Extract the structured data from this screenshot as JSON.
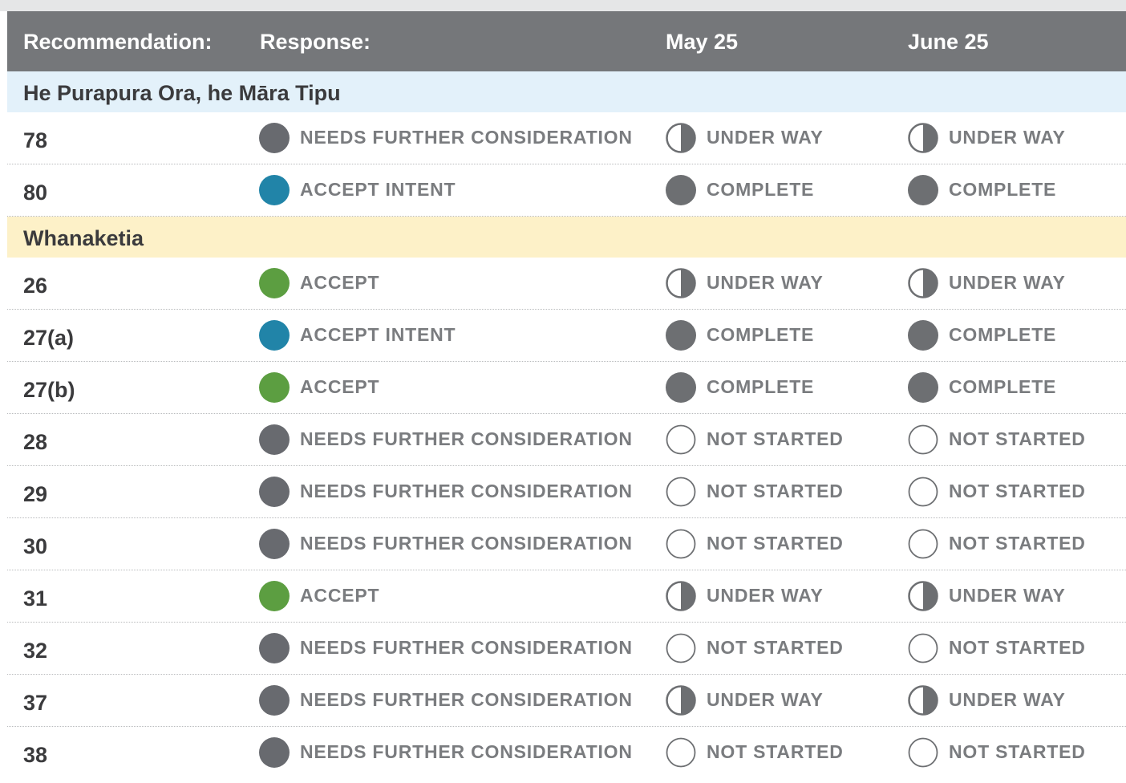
{
  "colors": {
    "header_bg": "#75777a",
    "section_blue": "#e3f1fa",
    "section_yellow": "#fdf1c8",
    "needs": "#686a6f",
    "accept_intent": "#2184a8",
    "accept": "#5c9e41",
    "status": "#6d6f72",
    "label_text": "#7a7c7f",
    "body_text": "#3b3b3d"
  },
  "header": {
    "recommendation": "Recommendation:",
    "response": "Response:",
    "may": "May 25",
    "june": "June 25"
  },
  "sections": [
    {
      "title": "He Purapura Ora, he Māra Tipu",
      "bg": "#e3f1fa",
      "rows": [
        {
          "rec": "78",
          "response": {
            "label": "NEEDS FURTHER CONSIDERATION",
            "kind": "needs"
          },
          "may": {
            "label": "UNDER WAY",
            "kind": "underway"
          },
          "june": {
            "label": "UNDER WAY",
            "kind": "underway"
          }
        },
        {
          "rec": "80",
          "response": {
            "label": "ACCEPT INTENT",
            "kind": "accept-intent"
          },
          "may": {
            "label": "COMPLETE",
            "kind": "complete"
          },
          "june": {
            "label": "COMPLETE",
            "kind": "complete"
          }
        }
      ]
    },
    {
      "title": "Whanaketia",
      "bg": "#fdf1c8",
      "rows": [
        {
          "rec": "26",
          "response": {
            "label": "ACCEPT",
            "kind": "accept"
          },
          "may": {
            "label": "UNDER WAY",
            "kind": "underway"
          },
          "june": {
            "label": "UNDER WAY",
            "kind": "underway"
          }
        },
        {
          "rec": "27(a)",
          "response": {
            "label": "ACCEPT INTENT",
            "kind": "accept-intent"
          },
          "may": {
            "label": "COMPLETE",
            "kind": "complete"
          },
          "june": {
            "label": "COMPLETE",
            "kind": "complete"
          }
        },
        {
          "rec": "27(b)",
          "response": {
            "label": "ACCEPT",
            "kind": "accept"
          },
          "may": {
            "label": "COMPLETE",
            "kind": "complete"
          },
          "june": {
            "label": "COMPLETE",
            "kind": "complete"
          }
        },
        {
          "rec": "28",
          "response": {
            "label": "NEEDS FURTHER CONSIDERATION",
            "kind": "needs"
          },
          "may": {
            "label": "NOT STARTED",
            "kind": "notstarted"
          },
          "june": {
            "label": "NOT STARTED",
            "kind": "notstarted"
          }
        },
        {
          "rec": "29",
          "response": {
            "label": "NEEDS FURTHER CONSIDERATION",
            "kind": "needs"
          },
          "may": {
            "label": "NOT STARTED",
            "kind": "notstarted"
          },
          "june": {
            "label": "NOT STARTED",
            "kind": "notstarted"
          }
        },
        {
          "rec": "30",
          "response": {
            "label": "NEEDS FURTHER CONSIDERATION",
            "kind": "needs"
          },
          "may": {
            "label": "NOT STARTED",
            "kind": "notstarted"
          },
          "june": {
            "label": "NOT STARTED",
            "kind": "notstarted"
          }
        },
        {
          "rec": "31",
          "response": {
            "label": "ACCEPT",
            "kind": "accept"
          },
          "may": {
            "label": "UNDER WAY",
            "kind": "underway"
          },
          "june": {
            "label": "UNDER WAY",
            "kind": "underway"
          }
        },
        {
          "rec": "32",
          "response": {
            "label": "NEEDS FURTHER CONSIDERATION",
            "kind": "needs"
          },
          "may": {
            "label": "NOT STARTED",
            "kind": "notstarted"
          },
          "june": {
            "label": "NOT STARTED",
            "kind": "notstarted"
          }
        },
        {
          "rec": "37",
          "response": {
            "label": "NEEDS FURTHER CONSIDERATION",
            "kind": "needs"
          },
          "may": {
            "label": "UNDER WAY",
            "kind": "underway"
          },
          "june": {
            "label": "UNDER WAY",
            "kind": "underway"
          }
        },
        {
          "rec": "38",
          "response": {
            "label": "NEEDS FURTHER CONSIDERATION",
            "kind": "needs"
          },
          "may": {
            "label": "NOT STARTED",
            "kind": "notstarted"
          },
          "june": {
            "label": "NOT STARTED",
            "kind": "notstarted"
          }
        }
      ]
    }
  ]
}
